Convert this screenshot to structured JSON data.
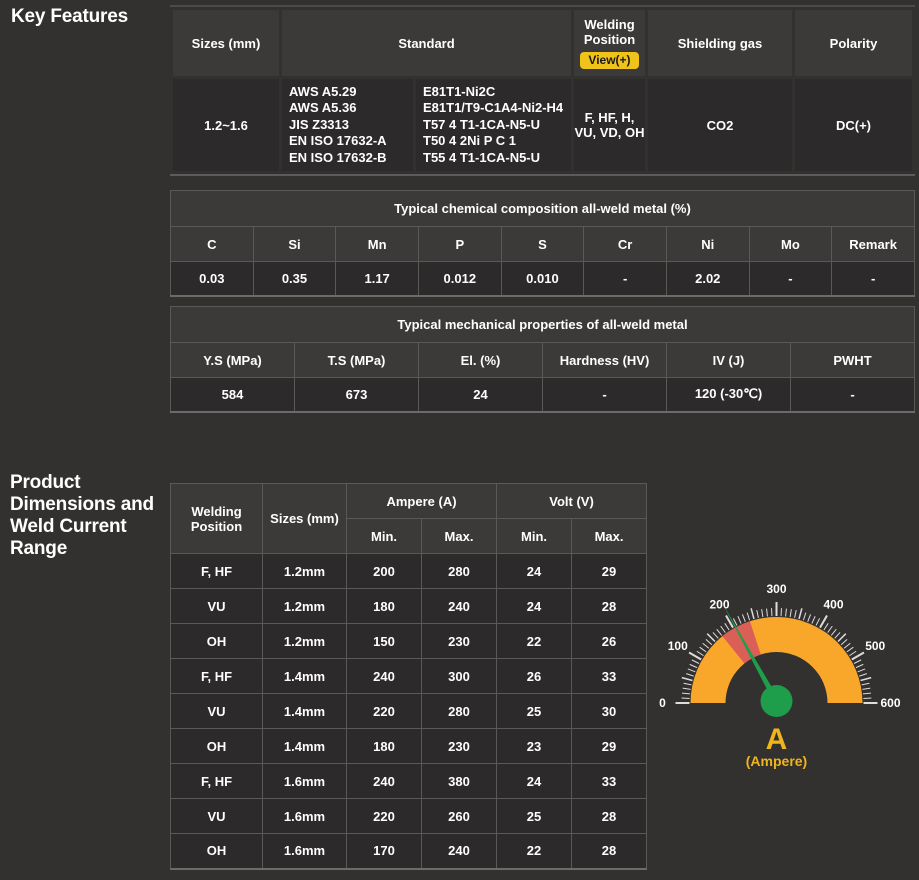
{
  "headings": {
    "key_features": "Key Features",
    "product_dimensions": "Product Dimensions and Weld Current Range"
  },
  "key_features_table": {
    "headers": {
      "sizes": "Sizes (mm)",
      "standard": "Standard",
      "welding_position": "Welding Position",
      "view_badge": "View(+)",
      "shielding_gas": "Shielding gas",
      "polarity": "Polarity"
    },
    "row": {
      "sizes": "1.2~1.6",
      "standard_specs": [
        "AWS A5.29",
        "AWS A5.36",
        "JIS Z3313",
        "EN ISO 17632-A",
        "EN ISO 17632-B"
      ],
      "standard_classes": [
        "E81T1-Ni2C",
        "E81T1/T9-C1A4-Ni2-H4",
        "T57 4 T1-1CA-N5-U",
        "T50 4 2Ni P C 1",
        "T55 4 T1-1CA-N5-U"
      ],
      "welding_position": "F, HF, H, VU, VD, OH",
      "shielding_gas": "CO2",
      "polarity": "DC(+)"
    }
  },
  "chemical_table": {
    "title": "Typical chemical composition all-weld metal (%)",
    "headers": [
      "C",
      "Si",
      "Mn",
      "P",
      "S",
      "Cr",
      "Ni",
      "Mo",
      "Remark"
    ],
    "values": [
      "0.03",
      "0.35",
      "1.17",
      "0.012",
      "0.010",
      "-",
      "2.02",
      "-",
      "-"
    ]
  },
  "mechanical_table": {
    "title": "Typical mechanical properties of all-weld metal",
    "headers": [
      "Y.S (MPa)",
      "T.S (MPa)",
      "El. (%)",
      "Hardness (HV)",
      "IV (J)",
      "PWHT"
    ],
    "values": [
      "584",
      "673",
      "24",
      "-",
      "120 (-30℃)",
      "-"
    ]
  },
  "current_table": {
    "headers": {
      "welding_position": "Welding Position",
      "sizes": "Sizes (mm)",
      "ampere": "Ampere (A)",
      "volt": "Volt (V)",
      "min": "Min.",
      "max": "Max."
    },
    "rows": [
      {
        "position": "F, HF",
        "size": "1.2mm",
        "a_min": "200",
        "a_max": "280",
        "v_min": "24",
        "v_max": "29"
      },
      {
        "position": "VU",
        "size": "1.2mm",
        "a_min": "180",
        "a_max": "240",
        "v_min": "24",
        "v_max": "28"
      },
      {
        "position": "OH",
        "size": "1.2mm",
        "a_min": "150",
        "a_max": "230",
        "v_min": "22",
        "v_max": "26"
      },
      {
        "position": "F, HF",
        "size": "1.4mm",
        "a_min": "240",
        "a_max": "300",
        "v_min": "26",
        "v_max": "33"
      },
      {
        "position": "VU",
        "size": "1.4mm",
        "a_min": "220",
        "a_max": "280",
        "v_min": "25",
        "v_max": "30"
      },
      {
        "position": "OH",
        "size": "1.4mm",
        "a_min": "180",
        "a_max": "230",
        "v_min": "23",
        "v_max": "29"
      },
      {
        "position": "F, HF",
        "size": "1.6mm",
        "a_min": "240",
        "a_max": "380",
        "v_min": "24",
        "v_max": "33"
      },
      {
        "position": "VU",
        "size": "1.6mm",
        "a_min": "220",
        "a_max": "260",
        "v_min": "25",
        "v_max": "28"
      },
      {
        "position": "OH",
        "size": "1.6mm",
        "a_min": "170",
        "a_max": "240",
        "v_min": "22",
        "v_max": "28"
      }
    ]
  },
  "gauge": {
    "type": "gauge",
    "min": 0,
    "max": 600,
    "major_tick_step": 100,
    "minor_tick_step": 10,
    "labels": [
      "0",
      "100",
      "200",
      "300",
      "400",
      "500",
      "600"
    ],
    "needle_value": 205,
    "red_zone": {
      "from": 170,
      "to": 240
    },
    "band_color": "#f9a72b",
    "red_color": "#d95f57",
    "needle_color": "#1e9e4a",
    "tick_color": "#dedcdc",
    "unit_letter": "A",
    "unit_label": "(Ampere)"
  },
  "colors": {
    "page_background": "#333030",
    "header_cell": "#3c3939",
    "body_cell": "#2c2a2a",
    "accent_yellow": "#f0b41c",
    "badge_yellow": "#efc319"
  }
}
